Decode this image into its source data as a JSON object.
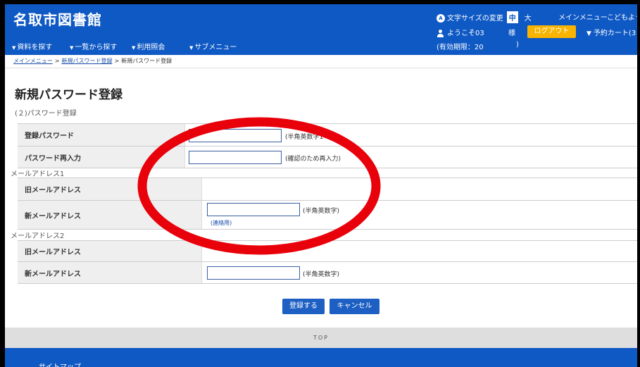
{
  "header": {
    "logo": "名取市図書館",
    "nav": [
      {
        "label": "資料を探す"
      },
      {
        "label": "一覧から探す"
      },
      {
        "label": "利用照会"
      },
      {
        "label": "サブメニュー"
      }
    ],
    "text_size_label": "文字サイズの変更",
    "text_size_mid": "中",
    "text_size_large": "大",
    "main_menu": "メインメニュー",
    "kids": "こどもよう",
    "welcome": "ようこそ03",
    "honorific": "様",
    "logout": "ログアウト",
    "cart": "予約カート(3",
    "validity": "(有効期限：20",
    "validity_close": ")"
  },
  "breadcrumb": {
    "home": "メインメニュー",
    "parent": "新規パスワード登録",
    "current": "新規パスワード登録",
    "sep": ">"
  },
  "page": {
    "title": "新規パスワード登録",
    "section": "(２)パスワード登録"
  },
  "password": {
    "register_label": "登録パスワード",
    "register_hint": "(半角英数字1～8",
    "register_value": "",
    "confirm_label": "パスワード再入力",
    "confirm_hint": "(確認のため再入力)",
    "confirm_value": ""
  },
  "email1": {
    "group": "メールアドレス1",
    "old_label": "旧メールアドレス",
    "old_value": "",
    "new_label": "新メールアドレス",
    "new_hint": "(半角英数字)",
    "new_sub": "(連絡用)",
    "new_value": ""
  },
  "email2": {
    "group": "メールアドレス2",
    "old_label": "旧メールアドレス",
    "old_value": "",
    "new_label": "新メールアドレス",
    "new_hint": "(半角英数字)",
    "new_value": ""
  },
  "actions": {
    "register": "登録する",
    "cancel": "キャンセル"
  },
  "footer": {
    "top": "TOP",
    "sitemap": "サイトマップ"
  },
  "colors": {
    "header_blue": "#0f59c4",
    "logout_orange": "#f8b400",
    "annotation_red": "#e8000b"
  }
}
